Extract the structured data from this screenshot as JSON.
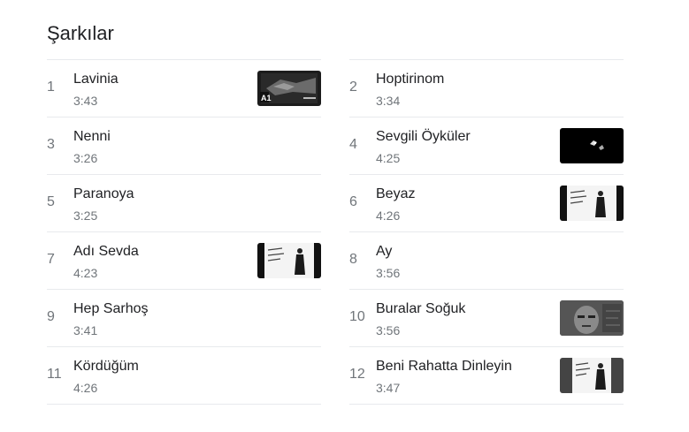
{
  "heading": "Şarkılar",
  "songs": [
    {
      "num": "1",
      "title": "Lavinia",
      "duration": "3:43",
      "thumb": "video-thumbnail-dark-scene"
    },
    {
      "num": "2",
      "title": "Hoptirinom",
      "duration": "3:34",
      "thumb": null
    },
    {
      "num": "3",
      "title": "Nenni",
      "duration": "3:26",
      "thumb": null
    },
    {
      "num": "4",
      "title": "Sevgili Öyküler",
      "duration": "4:25",
      "thumb": "video-thumbnail-black"
    },
    {
      "num": "5",
      "title": "Paranoya",
      "duration": "3:25",
      "thumb": null
    },
    {
      "num": "6",
      "title": "Beyaz",
      "duration": "4:26",
      "thumb": "album-cover-figure"
    },
    {
      "num": "7",
      "title": "Adı Sevda",
      "duration": "4:23",
      "thumb": "album-cover-figure"
    },
    {
      "num": "8",
      "title": "Ay",
      "duration": "3:56",
      "thumb": null
    },
    {
      "num": "9",
      "title": "Hep Sarhoş",
      "duration": "3:41",
      "thumb": null
    },
    {
      "num": "10",
      "title": "Buralar Soğuk",
      "duration": "3:56",
      "thumb": "video-thumbnail-face"
    },
    {
      "num": "11",
      "title": "Kördüğüm",
      "duration": "4:26",
      "thumb": null
    },
    {
      "num": "12",
      "title": "Beni Rahatta Dinleyin",
      "duration": "3:47",
      "thumb": "album-cover-figure"
    }
  ]
}
